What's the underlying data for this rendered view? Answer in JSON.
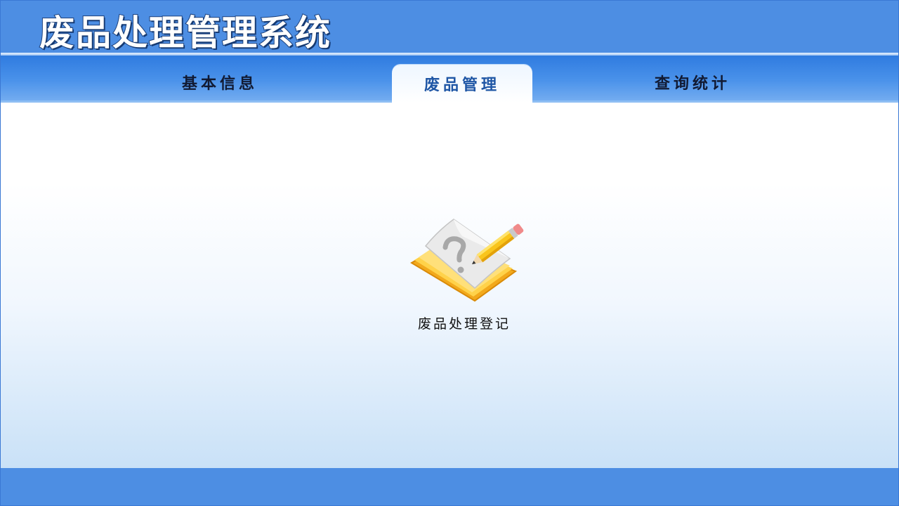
{
  "app": {
    "title": "废品处理管理系统"
  },
  "nav": {
    "tabs": [
      {
        "label": "基本信息",
        "active": false
      },
      {
        "label": "废品管理",
        "active": true
      },
      {
        "label": "查询统计",
        "active": false
      }
    ]
  },
  "main": {
    "modules": [
      {
        "label": "废品处理登记",
        "icon": "notebook-pencil-icon"
      }
    ]
  },
  "colors": {
    "title_bar": "#4d8ee3",
    "nav_bar": "#3f87e6",
    "active_tab_text": "#1f56a5",
    "footer_bar": "#4d8ee3"
  }
}
